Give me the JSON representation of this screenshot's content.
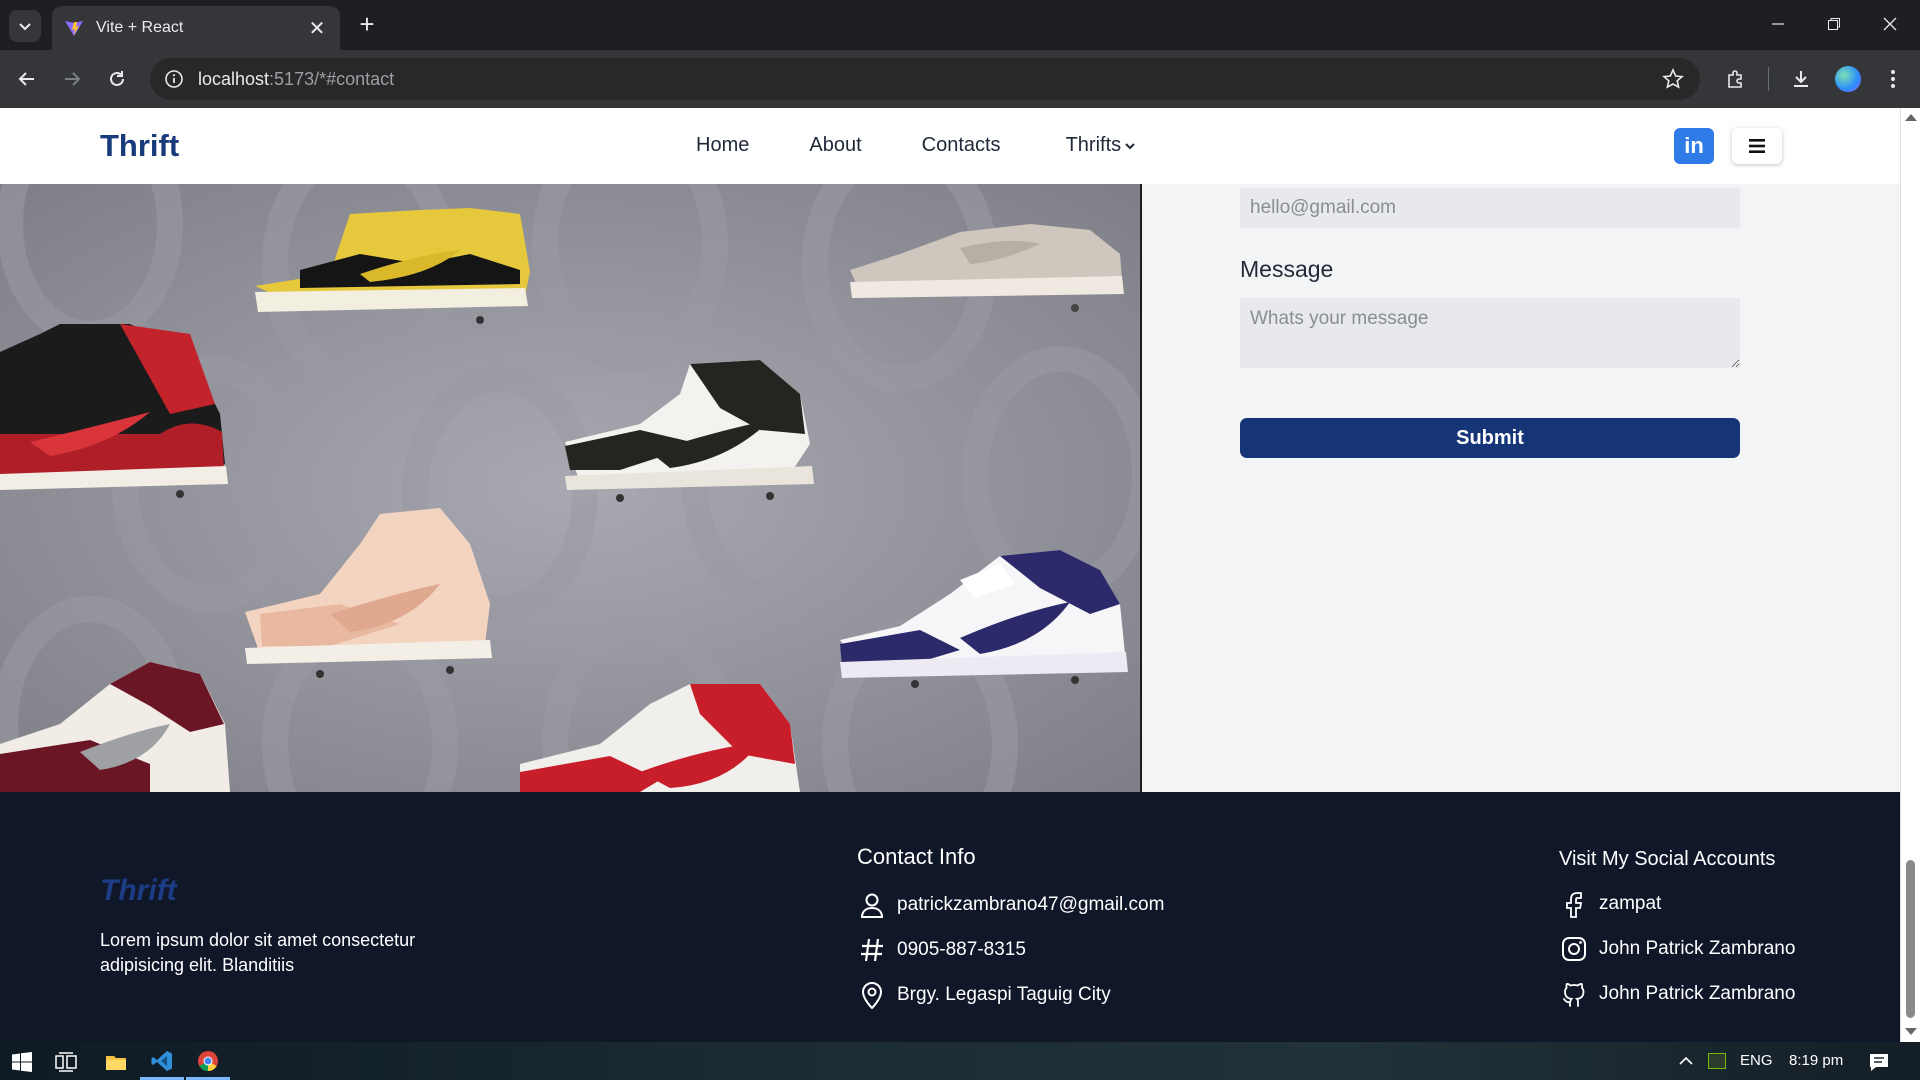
{
  "browser": {
    "tab_title": "Vite + React",
    "url_host": "localhost",
    "url_rest": ":5173/*#contact"
  },
  "nav": {
    "brand": "Thrift",
    "links": [
      "Home",
      "About",
      "Contacts",
      "Thrifts"
    ],
    "linkedin_label": "in"
  },
  "form": {
    "email_placeholder": "hello@gmail.com",
    "message_label": "Message",
    "message_placeholder": "Whats your message",
    "submit_label": "Submit"
  },
  "footer": {
    "brand": "Thrift",
    "description": "Lorem ipsum dolor sit amet consectetur adipisicing elit. Blanditiis",
    "contact_title": "Contact Info",
    "contact_items": [
      {
        "icon": "user-icon",
        "text": "patrickzambrano47@gmail.com"
      },
      {
        "icon": "hash-icon",
        "text": "0905-887-8315"
      },
      {
        "icon": "location-pin-icon",
        "text": "Brgy. Legaspi Taguig City"
      }
    ],
    "social_title": "Visit My Social Accounts",
    "social_items": [
      {
        "icon": "facebook-icon",
        "text": "zampat"
      },
      {
        "icon": "instagram-icon",
        "text": "John Patrick Zambrano"
      },
      {
        "icon": "github-icon",
        "text": "John Patrick Zambrano"
      }
    ]
  },
  "taskbar": {
    "language": "ENG",
    "time": "8:19 pm"
  },
  "colors": {
    "brand_navy": "#173a7a",
    "submit_bg": "#153577",
    "footer_bg": "#0f1729",
    "linkedin_bg": "#2f7be8"
  }
}
